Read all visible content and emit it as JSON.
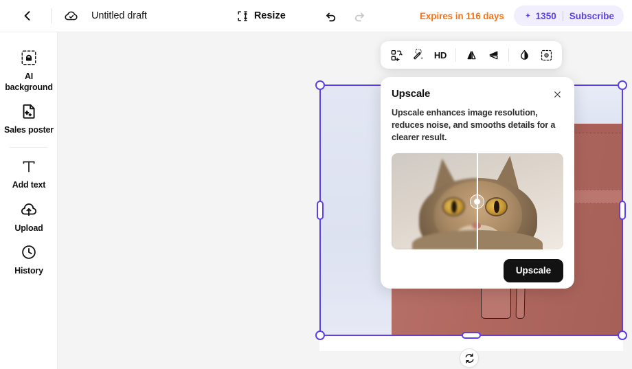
{
  "header": {
    "back_icon": "chevron-left-icon",
    "cloud_icon": "cloud-saved-icon",
    "title": "Untitled draft",
    "resize_label": "Resize",
    "resize_icon": "resize-icon",
    "undo_icon": "undo-icon",
    "redo_icon": "redo-icon",
    "expires_text": "Expires in 116 days",
    "expires_color": "#F97316",
    "credits_icon": "sparkle-icon",
    "credits_value": "1350",
    "subscribe_label": "Subscribe",
    "accent_color": "#5B3FE8"
  },
  "sidebar": {
    "items": [
      {
        "label": "AI\nbackground",
        "icon": "ai-background-icon"
      },
      {
        "label": "Sales poster",
        "icon": "sales-poster-icon"
      },
      {
        "label": "Add text",
        "icon": "text-icon"
      },
      {
        "label": "Upload",
        "icon": "upload-cloud-icon"
      },
      {
        "label": "History",
        "icon": "clock-history-icon"
      }
    ]
  },
  "toolbar": {
    "buttons": [
      {
        "name": "replace-object",
        "icon": "swap-objects-icon",
        "label": ""
      },
      {
        "name": "retouch",
        "icon": "magic-wand-icon",
        "label": ""
      },
      {
        "name": "upscale-hd",
        "icon": "hd-text-icon",
        "label": "HD"
      },
      {
        "name": "flip-horizontal",
        "icon": "flip-horizontal-icon",
        "label": ""
      },
      {
        "name": "flip-vertical",
        "icon": "flip-vertical-icon",
        "label": ""
      },
      {
        "name": "adjust-contrast",
        "icon": "contrast-droplet-icon",
        "label": ""
      },
      {
        "name": "select-subject",
        "icon": "select-subject-icon",
        "label": ""
      }
    ]
  },
  "popup": {
    "title": "Upscale",
    "close_icon": "close-icon",
    "description": "Upscale enhances image resolution, reduces noise, and smooths details for a clearer result.",
    "preview_alt": "before-after-cat-comparison",
    "action_label": "Upscale"
  },
  "canvas": {
    "background_color": "#F4F4F4",
    "artboard_alt": "pink-leather-handbag",
    "selection_color": "#5B3FE8",
    "rotate_icon": "rotate-icon"
  }
}
